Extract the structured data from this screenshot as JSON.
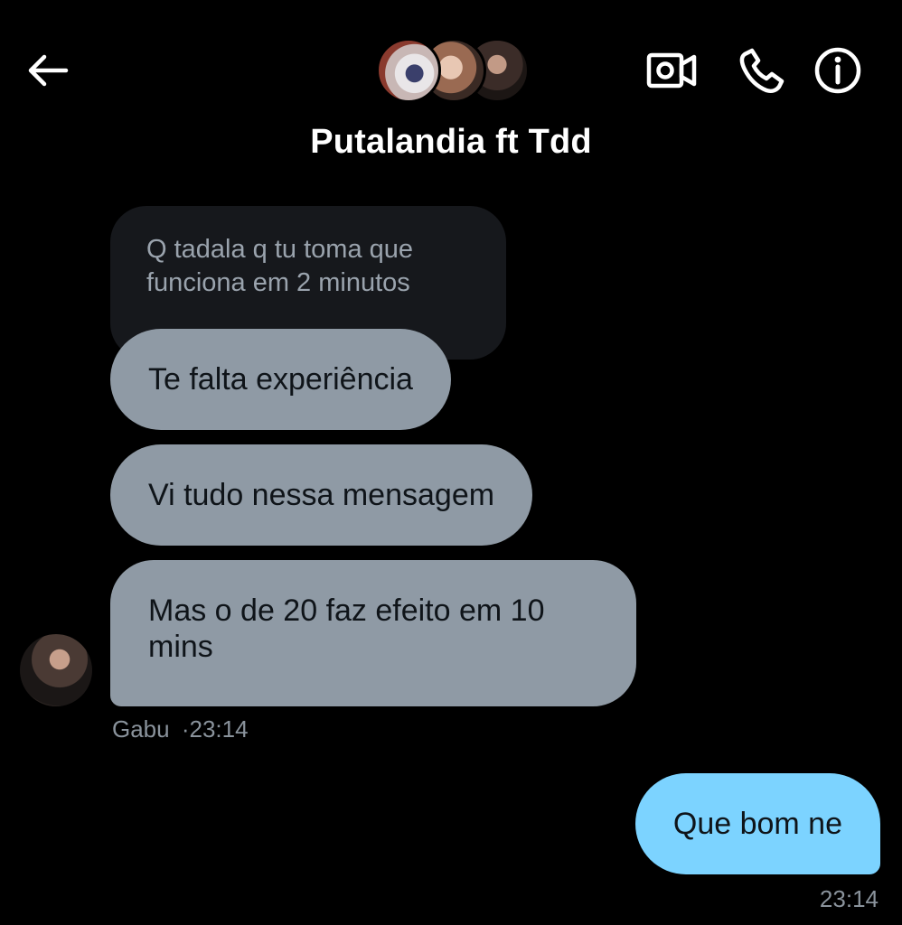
{
  "header": {
    "title": "Putalandia ft Tdd"
  },
  "messages": {
    "reply_preview": "Q tadala q tu toma que funciona em 2 minutos",
    "received": [
      "Te falta experiência",
      "Vi tudo nessa mensagem",
      "Mas o de 20 faz efeito em 10 mins"
    ],
    "received_sender": "Gabu",
    "received_separator": "·",
    "received_time": "23:14",
    "sent": [
      "Que bom ne"
    ],
    "sent_time": "23:14"
  },
  "icons": {
    "back": "arrow-left-icon",
    "video": "video-camera-icon",
    "call": "phone-icon",
    "info": "info-icon"
  },
  "colors": {
    "background": "#000000",
    "received_bubble": "#8f9aa5",
    "sent_bubble": "#7cd3ff",
    "reply_preview_bg": "#16181c",
    "meta_text": "#8a939c"
  }
}
